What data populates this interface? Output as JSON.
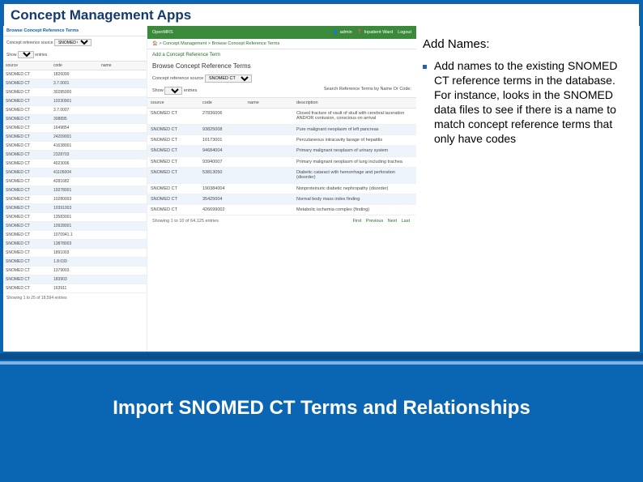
{
  "title": "Concept Management Apps",
  "right_panel": {
    "heading": "Add Names:",
    "bullet": "Add names to the existing SNOMED CT reference terms in the database. For instance, looks in the SNOMED data files to see if there is a name to match concept reference terms that only have codes"
  },
  "footer_headline": "Import SNOMED CT Terms and Relationships",
  "shot_a": {
    "header": "Browse Concept Reference Terms",
    "src_label": "Concept reference source",
    "src_value": "SNOMED CT",
    "show_prefix": "Show",
    "show_value": "25",
    "show_suffix": "entries",
    "cols": [
      "source",
      "code",
      "name"
    ],
    "rows": [
      [
        "SNOMED CT",
        "1826000",
        ""
      ],
      [
        "SNOMED CT",
        "3.7.0001",
        ""
      ],
      [
        "SNOMED CT",
        "30285000",
        ""
      ],
      [
        "SNOMED CT",
        "10230901",
        ""
      ],
      [
        "SNOMED CT",
        "3.7.0007",
        ""
      ],
      [
        "SNOMED CT",
        "308895",
        ""
      ],
      [
        "SNOMED CT",
        "1649854",
        ""
      ],
      [
        "SNOMED CT",
        "24209001",
        ""
      ],
      [
        "SNOMED CT",
        "41638001",
        ""
      ],
      [
        "SNOMED CT",
        "2328703",
        ""
      ],
      [
        "SNOMED CT",
        "4023006",
        ""
      ],
      [
        "SNOMED CT",
        "41105004",
        ""
      ],
      [
        "SNOMED CT",
        "4281682",
        ""
      ],
      [
        "SNOMED CT",
        "19278001",
        ""
      ],
      [
        "SNOMED CT",
        "10280003",
        ""
      ],
      [
        "SNOMED CT",
        "10391003",
        ""
      ],
      [
        "SNOMED CT",
        "13583001",
        ""
      ],
      [
        "SNOMED CT",
        "10928001",
        ""
      ],
      [
        "SNOMED CT",
        "1070941.1",
        ""
      ],
      [
        "SNOMED CT",
        "13878003",
        ""
      ],
      [
        "SNOMED CT",
        "1891003",
        ""
      ],
      [
        "SNOMED CT",
        "1.8:030",
        ""
      ],
      [
        "SNOMED CT",
        "1379003",
        ""
      ],
      [
        "SNOMED CT",
        "183903",
        ""
      ],
      [
        "SNOMED CT",
        "163911",
        ""
      ]
    ],
    "footer": "Showing 1 to 25 of 18,594 entries"
  },
  "shot_b": {
    "brand": "OpenMRS",
    "top_links": {
      "user": "admin",
      "ward": "Inpatient Ward",
      "logout": "Logout"
    },
    "crumb_home": "Home",
    "crumb_mgmt": "Concept Management",
    "crumb_last": "Browse Concept Reference Terms",
    "add_link": "Add a Concept Reference Term",
    "h2": "Browse Concept Reference Terms",
    "src_label": "Concept reference source",
    "src_value": "SNOMED CT",
    "show_prefix": "Show",
    "show_value": "10",
    "show_suffix": "entries",
    "search_label": "Search Reference Terms by Name Or Code:",
    "cols": [
      "source",
      "code",
      "name",
      "description"
    ],
    "rows": [
      [
        "SNOMED CT",
        "27836006",
        "",
        "Closed fracture of vault of skull with cerebral laceration AND/OR contusion, conscious on arrival"
      ],
      [
        "SNOMED CT",
        "93825008",
        "",
        "Pure malignant neoplasm of left pancreas"
      ],
      [
        "SNOMED CT",
        "10173001",
        "",
        "Percutaneous intracavity lavage of hepatitis"
      ],
      [
        "SNOMED CT",
        "94684004",
        "",
        "Primary malignant neoplasm of urinary system"
      ],
      [
        "SNOMED CT",
        "93940007",
        "",
        "Primary malignant neoplasm of lung including trachea"
      ],
      [
        "SNOMED CT",
        "53813050",
        "",
        "Diabetic cataract with hemorrhage and perforation (disorder)"
      ],
      [
        "SNOMED CT",
        "190384004",
        "",
        "Nonproteinuric diabetic nephropathy (disorder)"
      ],
      [
        "SNOMED CT",
        "35425004",
        "",
        "Normal body mass index finding"
      ],
      [
        "SNOMED CT",
        "426699002",
        "",
        "Metabolic ischemia complex (finding)"
      ]
    ],
    "footer_left": "Showing 1 to 10 of 64,125 entries",
    "pager": {
      "first": "First",
      "prev": "Previous",
      "next": "Next",
      "last": "Last"
    }
  }
}
